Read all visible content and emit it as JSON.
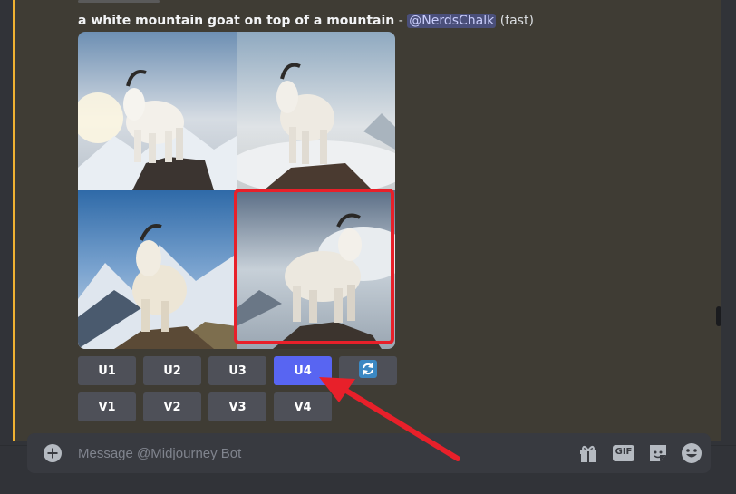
{
  "message": {
    "prompt": "a white mountain goat on top of a mountain",
    "separator": " - ",
    "mention": "@NerdsChalk",
    "mode": "(fast)"
  },
  "image_grid": {
    "images": [
      {
        "label": "goat image 1"
      },
      {
        "label": "goat image 2"
      },
      {
        "label": "goat image 3"
      },
      {
        "label": "goat image 4 (highlighted)"
      }
    ]
  },
  "buttons": {
    "upscale": [
      "U1",
      "U2",
      "U3",
      "U4"
    ],
    "variation": [
      "V1",
      "V2",
      "V3",
      "V4"
    ],
    "active": "U4",
    "reroll_icon": "refresh-icon"
  },
  "composer": {
    "placeholder": "Message @Midjourney Bot",
    "icons": [
      "add-icon",
      "gift-icon",
      "gif-icon",
      "sticker-icon",
      "emoji-icon"
    ],
    "gif_label": "GIF"
  },
  "colors": {
    "accent": "#5865f2",
    "highlight": "#e8202a",
    "mention_bar": "#f0b232"
  }
}
